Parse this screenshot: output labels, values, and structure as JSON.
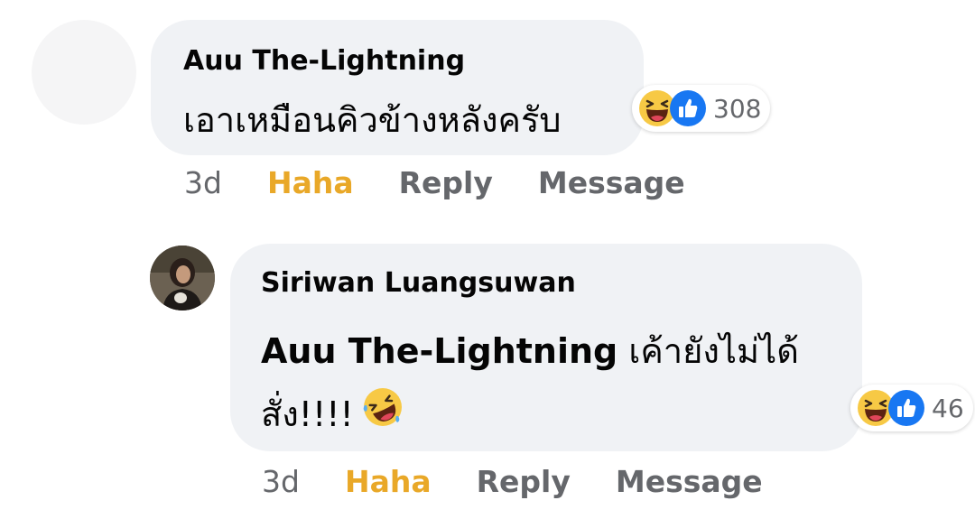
{
  "comments": [
    {
      "author": "Auu The-Lightning",
      "text": "เอาเหมือนคิวข้างหลังครับ",
      "reactions": {
        "icons": [
          "haha-icon",
          "like-icon"
        ],
        "count": "308"
      },
      "time": "3d",
      "actions": {
        "haha": "Haha",
        "reply": "Reply",
        "message": "Message"
      }
    },
    {
      "author": "Siriwan Luangsuwan",
      "mention": "Auu The-Lightning",
      "text_line1": "เค้ายังไม่ได้",
      "text_line2": "สั่ง!!!!",
      "emoji": "rolling-on-floor-laughing-icon",
      "reactions": {
        "icons": [
          "haha-icon",
          "like-icon"
        ],
        "count": "46"
      },
      "time": "3d",
      "actions": {
        "haha": "Haha",
        "reply": "Reply",
        "message": "Message"
      }
    }
  ],
  "colors": {
    "bubble": "#f0f2f5",
    "haha_active": "#e9a828",
    "secondary_text": "#65676b",
    "like_blue": "#1877f2",
    "haha_yellow": "#f7c945"
  }
}
